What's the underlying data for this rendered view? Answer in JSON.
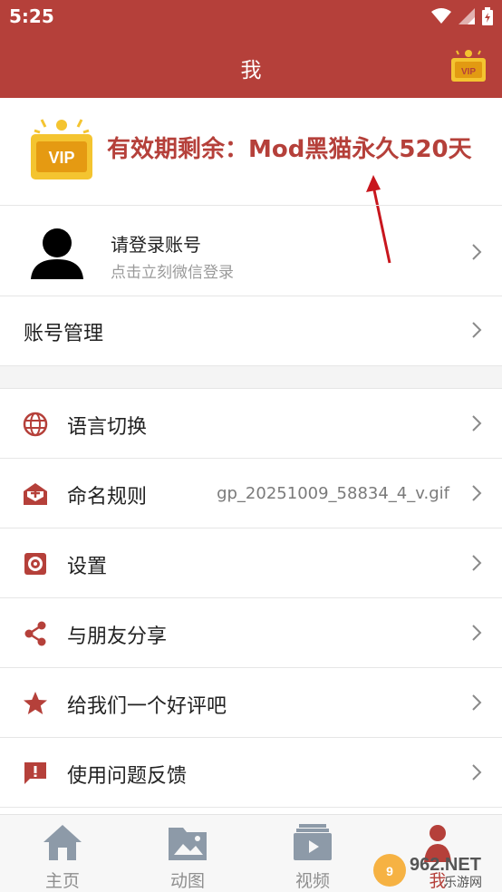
{
  "status_bar": {
    "time": "5:25"
  },
  "app_bar": {
    "title": "我"
  },
  "vip_banner": {
    "text": "有效期剩余：Mod黑猫永久520天",
    "badge_text": "VIP"
  },
  "account": {
    "login_title": "请登录账号",
    "login_subtitle": "点击立刻微信登录",
    "manage_label": "账号管理"
  },
  "menu": [
    {
      "label": "语言切换",
      "value": "",
      "icon": "globe-icon"
    },
    {
      "label": "命名规则",
      "value": "gp_20251009_58834_4_v.gif",
      "icon": "mail-open-icon"
    },
    {
      "label": "设置",
      "value": "",
      "icon": "gear-icon"
    },
    {
      "label": "与朋友分享",
      "value": "",
      "icon": "share-icon"
    },
    {
      "label": "给我们一个好评吧",
      "value": "",
      "icon": "star-icon"
    },
    {
      "label": "使用问题反馈",
      "value": "",
      "icon": "feedback-icon"
    }
  ],
  "bottom_nav": [
    {
      "label": "主页",
      "icon": "home-icon"
    },
    {
      "label": "动图",
      "icon": "image-folder-icon"
    },
    {
      "label": "视频",
      "icon": "video-icon"
    },
    {
      "label": "我",
      "icon": "profile-icon"
    }
  ],
  "watermark": {
    "brand": "962.NET",
    "subtext": "乐游网"
  },
  "colors": {
    "primary": "#b5403a",
    "vip_gold": "#f4c430",
    "text_gray": "#9a9a9a"
  }
}
